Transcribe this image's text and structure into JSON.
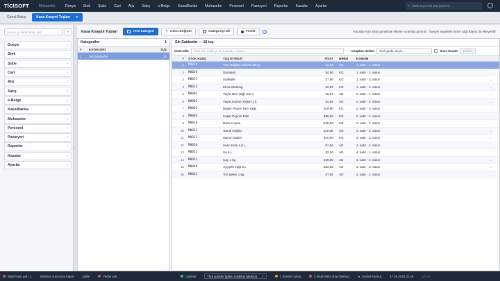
{
  "app": {
    "logo": "TİCİSOFT",
    "module": "Muhasebe"
  },
  "top_menu": [
    "Dosya",
    "Stok",
    "Şube",
    "Cari",
    "Alış",
    "Satış",
    "e-Belge",
    "Kasa/Banka",
    "Muhasebe",
    "Personel",
    "Pazaryeri",
    "Raporlar",
    "Kasalar",
    "Ayarlar"
  ],
  "top_search": {
    "placeholder": "Stok veya cari ara (Ctrl+K)"
  },
  "tabs": [
    {
      "label": "Genel Bakış"
    },
    {
      "label": "Kasa Kısayol Tuşları",
      "close": "✕"
    }
  ],
  "sidebar": {
    "search_placeholder": "Ara ve ya ekran kodu yaz",
    "collapse": "«",
    "items": [
      "Dosya",
      "Stok",
      "Şube",
      "Cari",
      "Alış",
      "Satış",
      "e-Belge",
      "Kasa/Banka",
      "Muhasebe",
      "Personel",
      "Pazaryeri",
      "Raporlar",
      "Kasalar",
      "Ayarlar"
    ]
  },
  "toolbar": {
    "title": "Kasa Kısayol Tuşları",
    "new_category": "Yeni Kategori",
    "rename": "Adını Değiştir",
    "delete_category": "Kategoriyi Sil",
    "refresh": "Yenile",
    "hint": "Kasada Hızlı Satış panelinde ekleme sırasıyla görünür · kasiyer sepetteki ürüne sağ tıklayıp da ekleyebilir"
  },
  "categories": {
    "title": "Kategoriler",
    "count": "1",
    "headers": {
      "no": "#",
      "name": "KATEGORİ",
      "keys": "TUŞ"
    },
    "rows": [
      {
        "no": "1",
        "name": "Sık Satılanlar",
        "keys": "16"
      }
    ]
  },
  "keys_panel": {
    "title": "Sık Satılanlar — 16 tuş",
    "add_label": "Ürün ekle",
    "add_placeholder": "Ürün adı, kodu ya da barkodu; okutun...",
    "group_label": "Gruptan doldur",
    "group_select": "Stok grubu seçin...",
    "clear_first_label": "önce boşalt",
    "fill_button": "Doldur",
    "headers": {
      "no": "#",
      "code": "STOK KODU",
      "label": "TUŞ ETİKETİ",
      "price": "FİYAT",
      "unit": "BİRİM",
      "position": "KONUM"
    },
    "rows": [
      {
        "no": "1",
        "code": "M0030",
        "label": "Tam Buğday Ekmek 300 g",
        "price": "12,50",
        "unit": "AD",
        "position": "1. satır · 1. sütun",
        "selected": true
      },
      {
        "no": "2",
        "code": "M0020",
        "label": "Domates",
        "price": "34,90",
        "unit": "KG",
        "position": "1. satır · 2. sütun"
      },
      {
        "no": "3",
        "code": "M0021",
        "label": "Salatalık",
        "price": "27,90",
        "unit": "KG",
        "position": "1. satır · 3. sütun"
      },
      {
        "no": "4",
        "code": "M0022",
        "label": "Elma Starking",
        "price": "32,50",
        "unit": "KG",
        "position": "1. satır · 4. sütun"
      },
      {
        "no": "5",
        "code": "M0001",
        "label": "Yayla Tam Yağlı Süt 1",
        "price": "36,90",
        "unit": "AD",
        "position": "2. satır · 1. sütun"
      },
      {
        "no": "6",
        "code": "M0002",
        "label": "Yayla Süzme Yoğurt 1 k",
        "price": "54,50",
        "unit": "AD",
        "position": "2. satır · 2. sütun"
      },
      {
        "no": "7",
        "code": "M0003",
        "label": "Beyaz Peynir Tam Yağlı",
        "price": "319,90",
        "unit": "KG",
        "position": "2. satır · 3. sütun"
      },
      {
        "no": "8",
        "code": "M0004",
        "label": "Kaşar Peyniri Eski",
        "price": "489,90",
        "unit": "KG",
        "position": "2. satır · 4. sütun"
      },
      {
        "no": "9",
        "code": "M0010",
        "label": "Dana Kıyma",
        "price": "549,90",
        "unit": "KG",
        "position": "3. satır · 1. sütun"
      },
      {
        "no": "10",
        "code": "M0011",
        "label": "Tavuk Göğsü",
        "price": "219,90",
        "unit": "KG",
        "position": "3. satır · 2. sütun"
      },
      {
        "no": "11",
        "code": "M0012",
        "label": "Macar Salam",
        "price": "419,90",
        "unit": "KG",
        "position": "3. satır · 3. sütun"
      },
      {
        "no": "12",
        "code": "M0050",
        "label": "Serin Kola 2,5 L",
        "price": "67,90",
        "unit": "AD",
        "position": "3. satır · 4. sütun"
      },
      {
        "no": "13",
        "code": "M0051",
        "label": "Su 5 L",
        "price": "32,00",
        "unit": "AD",
        "position": "4. satır · 1. sütun"
      },
      {
        "no": "14",
        "code": "M0052",
        "label": "Çay 1 kg",
        "price": "249,90",
        "unit": "AD",
        "position": "4. satır · 2. sütun"
      },
      {
        "no": "15",
        "code": "M0040",
        "label": "Ayçiçek Yağı 5 L",
        "price": "353,50",
        "unit": "AD",
        "position": "4. satır · 3. sütun"
      },
      {
        "no": "16",
        "code": "M0042",
        "label": "Toz Şeker 1 kg",
        "price": "47,50",
        "unit": "AD",
        "position": "4. satır · 4. sütun"
      }
    ],
    "row_ellipsis": "..."
  },
  "status": {
    "disconnected": "Bağlı kasa yok / 1",
    "server": "Senkron sunucusu kapalı",
    "sync": "sqlite",
    "backup": "Yedek yok",
    "license": "Lisanslı",
    "branch_select": "Tüm şubeler (şube: Kadıköy Merkez)",
    "transfer": "1 transfer yolda",
    "offers": "2 ilmal talebi onay bekliyor",
    "user": "Ahmet Karaca",
    "datetime": "17.09.2026 21:26",
    "version": "v2.0.x"
  },
  "colors": {
    "accent": "#1f6fd1",
    "topbar": "#1d2a3a",
    "selected_row": "#8aa4e4"
  }
}
